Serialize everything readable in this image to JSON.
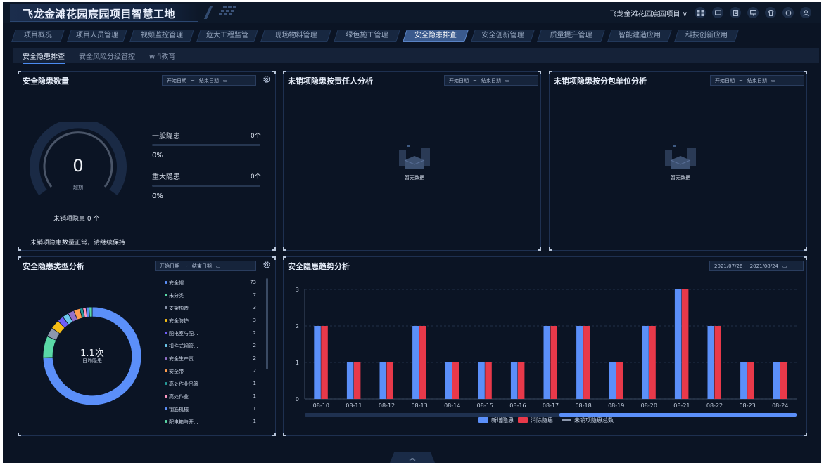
{
  "header": {
    "title": "飞龙金滩花园宸园项目智慧工地",
    "project_select": "飞龙金滩花园宸园项目",
    "colors": {
      "accent": "#4b8bf0",
      "bg": "#0b1424"
    }
  },
  "nav": {
    "tabs": [
      "项目概况",
      "项目人员管理",
      "视频监控管理",
      "危大工程监管",
      "现场物料管理",
      "绿色施工管理",
      "安全隐患排查",
      "安全创新管理",
      "质量提升管理",
      "智能建造应用",
      "科技创新应用"
    ],
    "active": "安全隐患排查"
  },
  "subnav": {
    "tabs": [
      "安全隐患排查",
      "安全风险分级管控",
      "wifi教育"
    ],
    "active": "安全隐患排查"
  },
  "date_start": "开始日期",
  "date_sep": "~",
  "date_end": "结束日期",
  "count_panel": {
    "title": "安全隐患数量",
    "gauge_value": "0",
    "gauge_label": "超期",
    "general_label": "一般隐患",
    "general_count": "0个",
    "general_pct": "0%",
    "major_label": "重大隐患",
    "major_count": "0个",
    "major_pct": "0%",
    "unsold_text": "未销项隐患 0 个",
    "status_text": "未销项隐患数量正常，请继续保持"
  },
  "responsible_panel": {
    "title": "未销项隐患按责任人分析",
    "empty": "暂无数据"
  },
  "subcontract_panel": {
    "title": "未销项隐患按分包单位分析",
    "empty": "暂无数据"
  },
  "type_panel": {
    "title": "安全隐患类型分析",
    "center_value": "1.1次",
    "center_label": "日均隐患",
    "items": [
      {
        "name": "安全帽",
        "value": 73,
        "color": "#5b8ff9"
      },
      {
        "name": "未分类",
        "value": 7,
        "color": "#5ad8a6"
      },
      {
        "name": "支架构造",
        "value": 3,
        "color": "#8c97ad"
      },
      {
        "name": "安全防护",
        "value": 3,
        "color": "#f6bd16"
      },
      {
        "name": "配电室与配...",
        "value": 2,
        "color": "#6f5ef9"
      },
      {
        "name": "扣件式钢管...",
        "value": 2,
        "color": "#6dc8ec"
      },
      {
        "name": "安全生产责...",
        "value": 2,
        "color": "#9270ca"
      },
      {
        "name": "安全带",
        "value": 2,
        "color": "#ff9d4d"
      },
      {
        "name": "高处作业吊篮",
        "value": 1,
        "color": "#269a99"
      },
      {
        "name": "高处作业",
        "value": 1,
        "color": "#ff99c3"
      },
      {
        "name": "钢筋机械",
        "value": 1,
        "color": "#5b8ff9"
      },
      {
        "name": "配电箱与开...",
        "value": 1,
        "color": "#5ad8a6"
      }
    ]
  },
  "trend_panel": {
    "title": "安全隐患趋势分析",
    "date_range": "2021/07/26 ~ 2021/08/24"
  },
  "chart_data": {
    "type": "bar",
    "categories": [
      "08-10",
      "08-11",
      "08-12",
      "08-13",
      "08-14",
      "08-15",
      "08-16",
      "08-17",
      "08-18",
      "08-19",
      "08-20",
      "08-21",
      "08-22",
      "08-23",
      "08-24"
    ],
    "series": [
      {
        "name": "新增隐患",
        "color": "#5b8ff9",
        "values": [
          2,
          1,
          1,
          2,
          1,
          1,
          1,
          2,
          2,
          1,
          2,
          3,
          2,
          1,
          1
        ]
      },
      {
        "name": "消除隐患",
        "color": "#e8394a",
        "values": [
          2,
          1,
          1,
          2,
          1,
          1,
          1,
          2,
          2,
          1,
          2,
          3,
          2,
          1,
          1
        ]
      },
      {
        "name": "未销项隐患总数",
        "color": "#8c97ad",
        "values": []
      }
    ],
    "y_ticks": [
      "0",
      "1",
      "2",
      "3"
    ],
    "ylim": [
      0,
      3
    ],
    "grid": true,
    "legend": "bottom"
  }
}
